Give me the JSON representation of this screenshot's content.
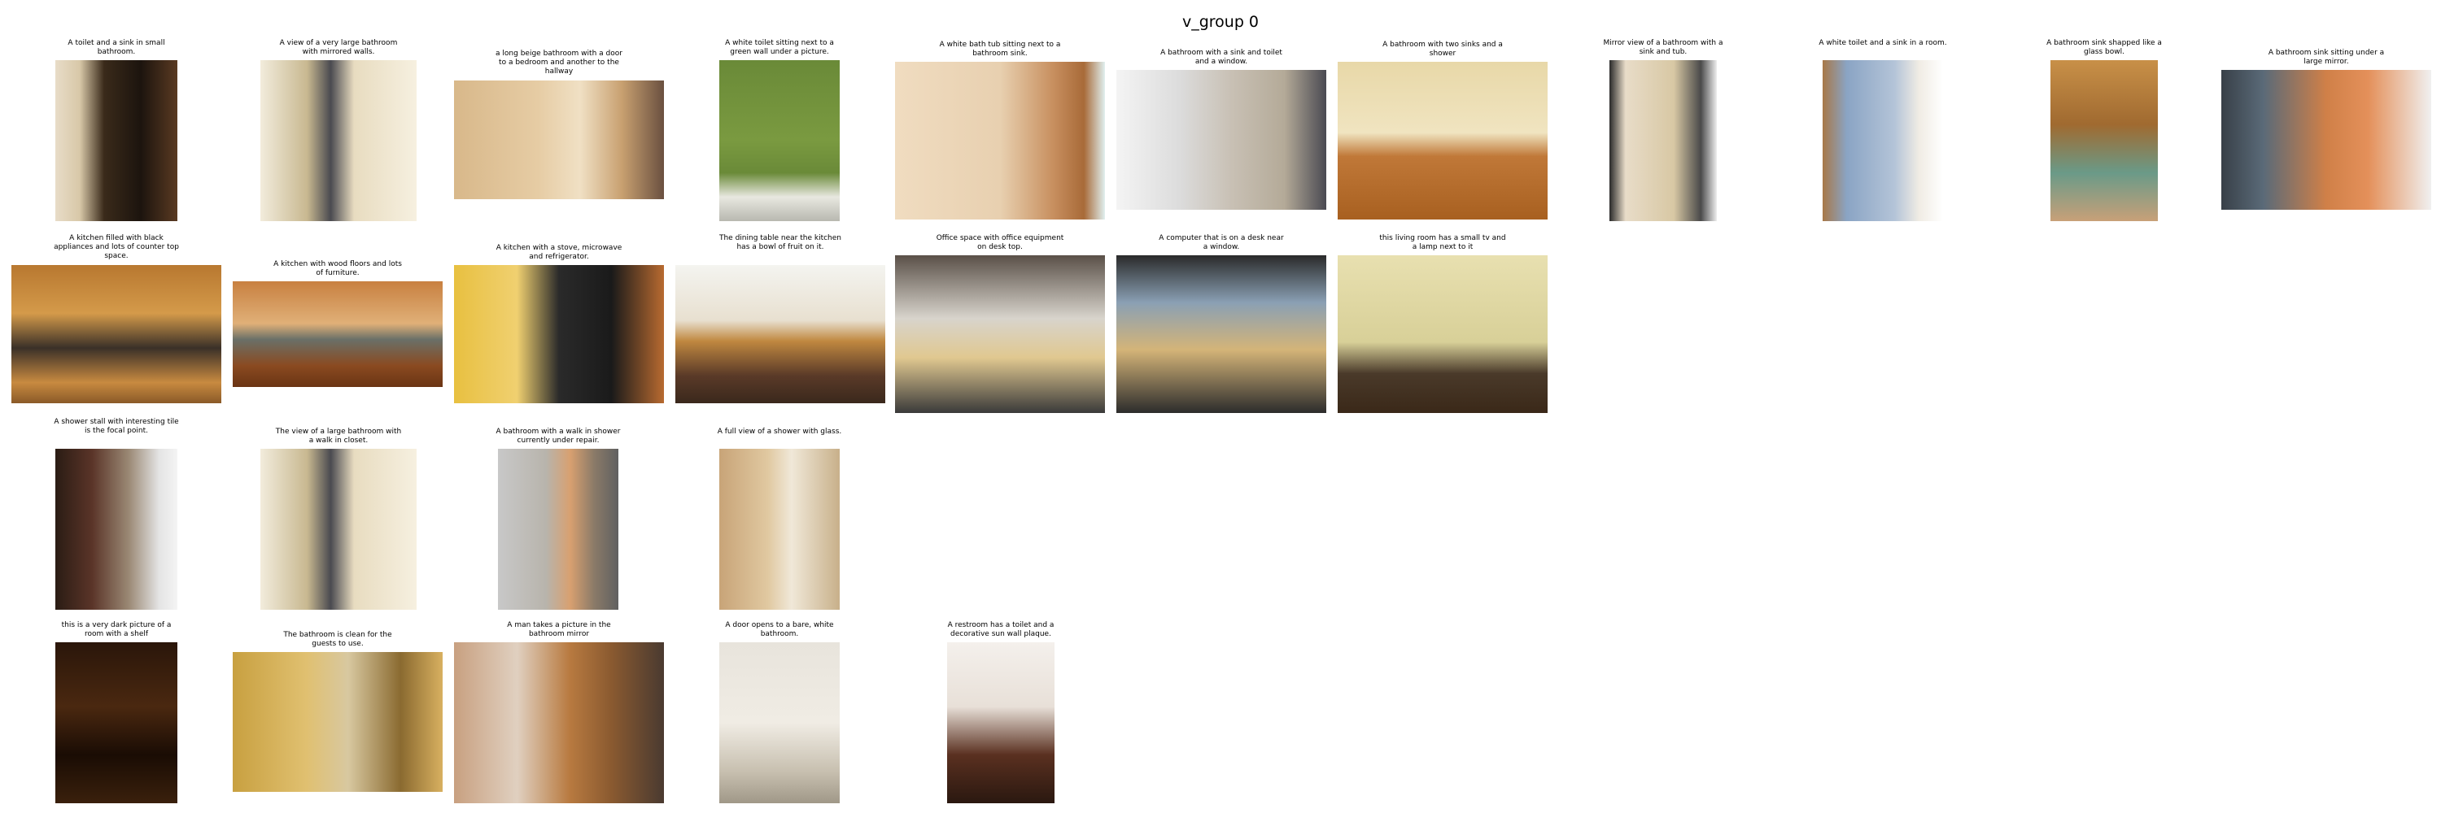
{
  "title": "v_group 0",
  "thumbs": [
    {
      "caption": "A toilet and a sink in small bathroom.",
      "palette": "dark-bath"
    },
    {
      "caption": "A view of a very large bathroom with mirrored walls.",
      "palette": "bright-hall"
    },
    {
      "caption": "a long beige bathroom with a door to a bedroom and another to the hallway",
      "palette": "beige-bath"
    },
    {
      "caption": "A white toilet sitting next to a green wall under a picture.",
      "palette": "green-wall"
    },
    {
      "caption": "A white bath tub sitting next to a bathroom sink.",
      "palette": "peach-tub"
    },
    {
      "caption": "A bathroom with a sink and toilet and a window.",
      "palette": "white-bath"
    },
    {
      "caption": "A bathroom with two sinks and a shower",
      "palette": "wood-vanity"
    },
    {
      "caption": "Mirror view of a bathroom with a sink and tub.",
      "palette": "mirror-view"
    },
    {
      "caption": "A white toilet and a sink in a room.",
      "palette": "blue-curtain"
    },
    {
      "caption": "A bathroom sink shapped like a glass bowl.",
      "palette": "glass-bowl"
    },
    {
      "caption": "A bathroom sink sitting under a large mirror.",
      "palette": "orange-mirror"
    },
    {
      "caption": "A kitchen filled with black appliances and lots of counter top space.",
      "palette": "kitchen-wood"
    },
    {
      "caption": "A kitchen with wood floors and lots of furniture.",
      "palette": "kitchen-floor"
    },
    {
      "caption": "A kitchen with a stove, microwave and refrigerator.",
      "palette": "kitchen-yellow"
    },
    {
      "caption": "The dining table near the kitchen has a bowl of fruit on it.",
      "palette": "dining"
    },
    {
      "caption": "Office space with office equipment on desk top.",
      "palette": "office"
    },
    {
      "caption": "A computer that is on a desk near a window.",
      "palette": "desk-window"
    },
    {
      "caption": "this living room has a small tv and a lamp next to it",
      "palette": "living"
    },
    {
      "caption": "A shower stall with interesting tile is the focal point.",
      "palette": "shower-dark"
    },
    {
      "caption": "The view of a large bathroom with a walk in closet.",
      "palette": "bright-hall"
    },
    {
      "caption": "A bathroom with a walk in shower currently under repair.",
      "palette": "repair"
    },
    {
      "caption": "A full view of a shower with glass.",
      "palette": "glass-shower"
    },
    {
      "caption": "this is a very dark picture of a room with a shelf",
      "palette": "very-dark"
    },
    {
      "caption": "The bathroom is clean for the guests to use.",
      "palette": "golden-bath"
    },
    {
      "caption": "A man takes a picture in the bathroom mirror",
      "palette": "man-mirror"
    },
    {
      "caption": "A door opens to a bare, white bathroom.",
      "palette": "bare-white"
    },
    {
      "caption": "A restroom has a toilet and a decorative sun wall plaque.",
      "palette": "sun-plaque"
    }
  ]
}
